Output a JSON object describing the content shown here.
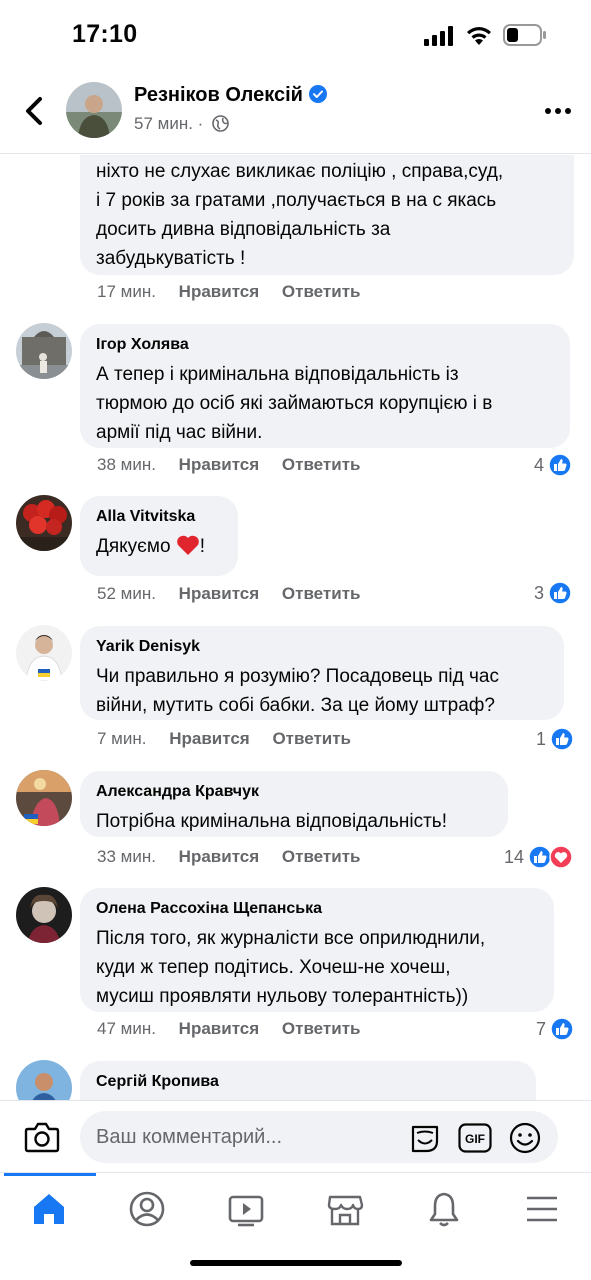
{
  "status_bar": {
    "time": "17:10"
  },
  "post_header": {
    "author": "Резніков Олексій",
    "time": "57 мин.",
    "separator": "·"
  },
  "colors": {
    "accent": "#1877f2",
    "bubble": "#f0f2f5",
    "muted": "#65676b",
    "love": "#f33e58"
  },
  "comments": [
    {
      "author": "",
      "text": "ніхто не слухає викликає поліцію , справа,суд,\nі 7 років за гратами ,получається в  на с якась\nдосить дивна відповідальність за\nзабудькуватість !",
      "time": "17 мин.",
      "like_label": "Нравится",
      "reply_label": "Ответить",
      "reactions": ""
    },
    {
      "author": "Ігор Холява",
      "text": "А тепер і кримінальна відповідальність  із\nтюрмою до осіб які займаються  корупцією і в\nармії під час війни.",
      "time": "38 мин.",
      "like_label": "Нравится",
      "reply_label": "Ответить",
      "reactions": "4"
    },
    {
      "author": "Alla Vitvitska",
      "text": "Дякуємо",
      "text_suffix": "!",
      "time": "52 мин.",
      "like_label": "Нравится",
      "reply_label": "Ответить",
      "reactions": "3"
    },
    {
      "author": "Yarik Denisyk",
      "text": "Чи правильно я розумію? Посадовець під час\nвійни, мутить собі бабки. За це йому штраф?",
      "time": "7 мин.",
      "like_label": "Нравится",
      "reply_label": "Ответить",
      "reactions": "1"
    },
    {
      "author": "Александра Кравчук",
      "text": "Потрібна кримінальна відповідальність!",
      "time": "33 мин.",
      "like_label": "Нравится",
      "reply_label": "Ответить",
      "reactions": "14"
    },
    {
      "author": "Олена Рассохіна Щепанська",
      "text": "Після того, як журналісти все оприлюднили,\nкуди ж тепер подітись. Хочеш-не хочеш,\nмусиш проявляти нульову толерантність))",
      "time": "47 мин.",
      "like_label": "Нравится",
      "reply_label": "Ответить",
      "reactions": "7"
    },
    {
      "author": "Сергій Кропива",
      "text": ""
    }
  ],
  "composer": {
    "placeholder": "Ваш комментарий...",
    "gif_label": "GIF"
  },
  "tabs": [
    "home-icon",
    "profile-icon",
    "video-icon",
    "marketplace-icon",
    "bell-icon",
    "menu-icon"
  ]
}
